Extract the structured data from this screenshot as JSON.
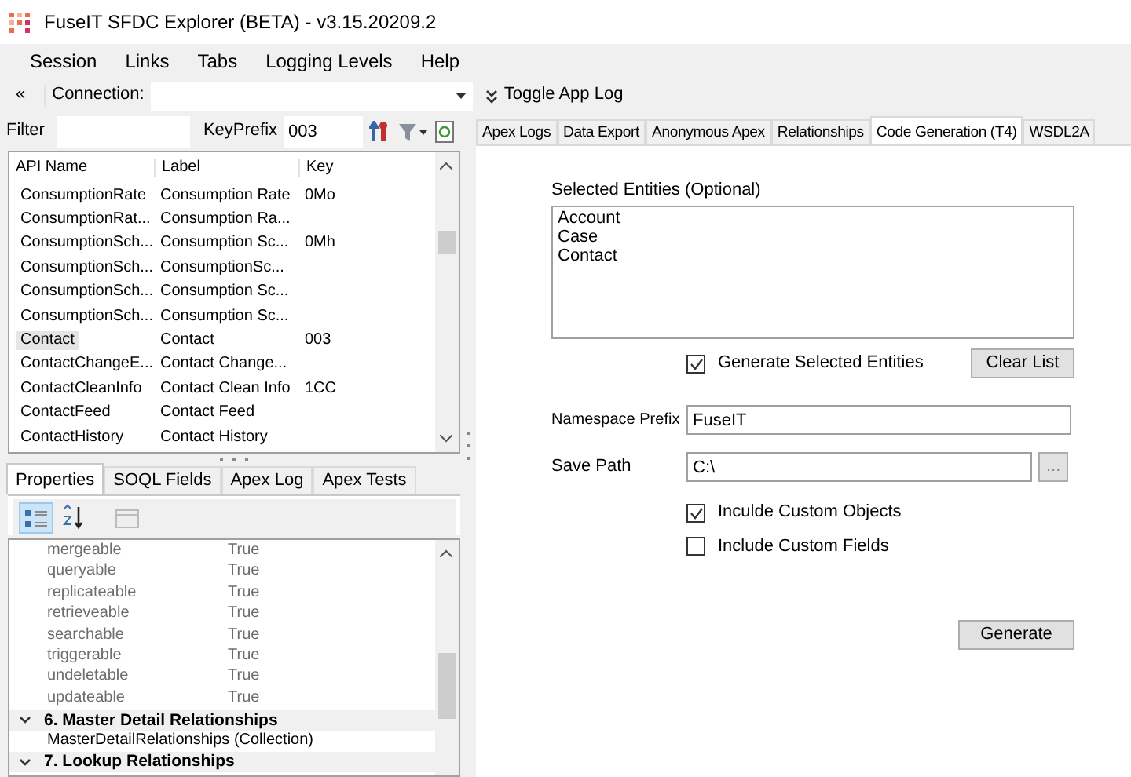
{
  "window": {
    "title": "FuseIT SFDC Explorer (BETA) - v3.15.20209.2"
  },
  "menu": [
    "Session",
    "Links",
    "Tabs",
    "Logging Levels",
    "Help"
  ],
  "toolbar": {
    "collapse": "«",
    "connection_label": "Connection:",
    "toggle_label": "Toggle App Log"
  },
  "filter": {
    "label": "Filter",
    "keyprefix_label": "KeyPrefix",
    "keyprefix_value": "003"
  },
  "entities": {
    "columns": [
      "API Name",
      "Label",
      "Key"
    ],
    "rows": [
      {
        "cells": [
          "ConsumptionRate",
          "Consumption Rate",
          "0Mo"
        ],
        "selected": false
      },
      {
        "cells": [
          "ConsumptionRat...",
          "Consumption Ra...",
          ""
        ],
        "selected": false
      },
      {
        "cells": [
          "ConsumptionSch...",
          "Consumption Sc...",
          "0Mh"
        ],
        "selected": false
      },
      {
        "cells": [
          "ConsumptionSch...",
          "ConsumptionSc...",
          ""
        ],
        "selected": false
      },
      {
        "cells": [
          "ConsumptionSch...",
          "Consumption Sc...",
          ""
        ],
        "selected": false
      },
      {
        "cells": [
          "ConsumptionSch...",
          "Consumption Sc...",
          ""
        ],
        "selected": false
      },
      {
        "cells": [
          "Contact",
          "Contact",
          "003"
        ],
        "selected": true
      },
      {
        "cells": [
          "ContactChangeE...",
          "Contact Change...",
          ""
        ],
        "selected": false
      },
      {
        "cells": [
          "ContactCleanInfo",
          "Contact Clean Info",
          "1CC"
        ],
        "selected": false
      },
      {
        "cells": [
          "ContactFeed",
          "Contact Feed",
          ""
        ],
        "selected": false
      },
      {
        "cells": [
          "ContactHistory",
          "Contact History",
          ""
        ],
        "selected": false
      }
    ]
  },
  "bottom_tabs": [
    {
      "label": "Properties",
      "selected": true
    },
    {
      "label": "SOQL Fields",
      "selected": false
    },
    {
      "label": "Apex Log",
      "selected": false
    },
    {
      "label": "Apex Tests",
      "selected": false
    }
  ],
  "property_toolbar": [
    {
      "kind": "categorized",
      "selected": true
    },
    {
      "kind": "alphabetical",
      "selected": false
    },
    {
      "kind": "pages",
      "selected": false
    }
  ],
  "properties": [
    {
      "kind": "property",
      "name": "mergeable",
      "value": "True"
    },
    {
      "kind": "property",
      "name": "queryable",
      "value": "True"
    },
    {
      "kind": "property",
      "name": "replicateable",
      "value": "True"
    },
    {
      "kind": "property",
      "name": "retrieveable",
      "value": "True"
    },
    {
      "kind": "property",
      "name": "searchable",
      "value": "True"
    },
    {
      "kind": "property",
      "name": "triggerable",
      "value": "True"
    },
    {
      "kind": "property",
      "name": "undeletable",
      "value": "True"
    },
    {
      "kind": "property",
      "name": "updateable",
      "value": "True"
    },
    {
      "kind": "category",
      "label": "6. Master Detail Relationships",
      "expanded": true
    },
    {
      "kind": "item",
      "label": "MasterDetailRelationships (Collection)"
    },
    {
      "kind": "category",
      "label": "7. Lookup Relationships",
      "expanded": true
    }
  ],
  "tabs": [
    {
      "label": "Apex Logs",
      "selected": false
    },
    {
      "label": "Data Export",
      "selected": false
    },
    {
      "label": "Anonymous Apex",
      "selected": false
    },
    {
      "label": "Relationships",
      "selected": false
    },
    {
      "label": "Code Generation (T4)",
      "selected": true
    },
    {
      "label": "WSDL2A",
      "selected": false
    }
  ],
  "code_generation": {
    "entities_label": "Selected Entities (Optional)",
    "entities": [
      "Account",
      "Case",
      "Contact"
    ],
    "generate_selected": {
      "label": "Generate Selected Entities",
      "checked": true
    },
    "clear_button": "Clear List",
    "namespace": {
      "label": "Namespace Prefix",
      "value": "FuseIT"
    },
    "save_path": {
      "label": "Save Path",
      "value": "C:\\"
    },
    "browse_button": "...",
    "options": [
      {
        "label": "Inculde Custom Objects",
        "checked": true
      },
      {
        "label": "Include Custom Fields",
        "checked": false
      }
    ],
    "generate_button": "Generate"
  }
}
